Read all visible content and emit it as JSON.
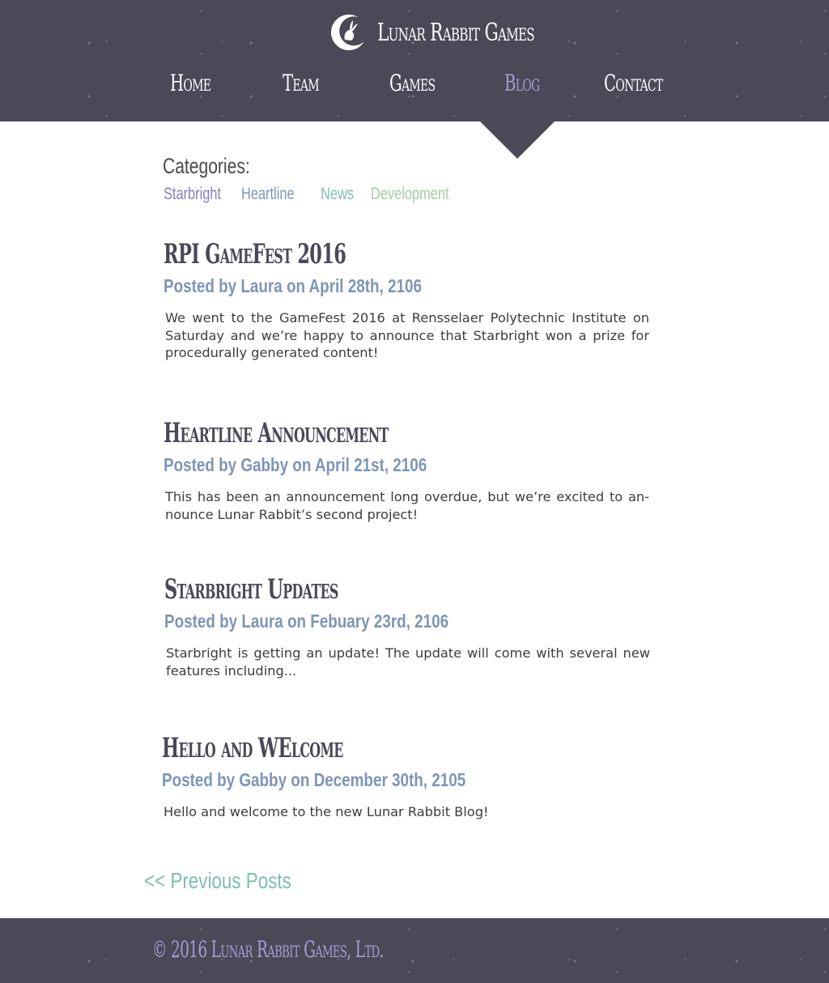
{
  "header": {
    "site_name": "Lunar Rabbit Games",
    "nav": [
      {
        "label": "Home"
      },
      {
        "label": "Team"
      },
      {
        "label": "Games"
      },
      {
        "label": "Blog",
        "active": true
      },
      {
        "label": "Contact"
      }
    ],
    "logo_icon": "moon-rabbit-icon"
  },
  "categories": {
    "heading": "Categories:",
    "items": [
      {
        "label": "Starbright",
        "color": "#8a7cc1"
      },
      {
        "label": "Heartline",
        "color": "#7e95b8"
      },
      {
        "label": "News",
        "color": "#7cbfb0"
      },
      {
        "label": "Development",
        "color": "#a3cca3"
      }
    ]
  },
  "posts": [
    {
      "title": "RPI GameFest 2016",
      "meta": "Posted by Laura on April 28th, 2106",
      "body": "We went to the GameFest 2016 at Rensselaer Polytechnic Institute on Sat­urday and we’re happy to announce that Starbright won a prize for proce­durally generated content!"
    },
    {
      "title": "Heartline Announcement",
      "meta": "Posted by Gabby on April 21st, 2106",
      "body": "This has been an announcement long overdue, but we’re excited to an­nounce Lunar Rabbit’s second project!"
    },
    {
      "title": "Starbright Updates",
      "meta": "Posted by Laura on Febuary 23rd, 2106",
      "body": "Starbright is getting an update! The update will come with several new fea­tures including..."
    },
    {
      "title": "Hello and WElcome",
      "meta": "Posted by Gabby on December 30th, 2105",
      "body": "Hello and welcome to the new Lunar Rabbit Blog!"
    }
  ],
  "pagination": {
    "previous_label": "<< Previous Posts"
  },
  "footer": {
    "copyright": "© 2016 Lunar Rabbit Games, Ltd."
  },
  "colors": {
    "header_bg": "#4b4858",
    "nav_active": "#a99bd3",
    "meta_text": "#7e95b8",
    "link_teal": "#7cbfb0"
  }
}
